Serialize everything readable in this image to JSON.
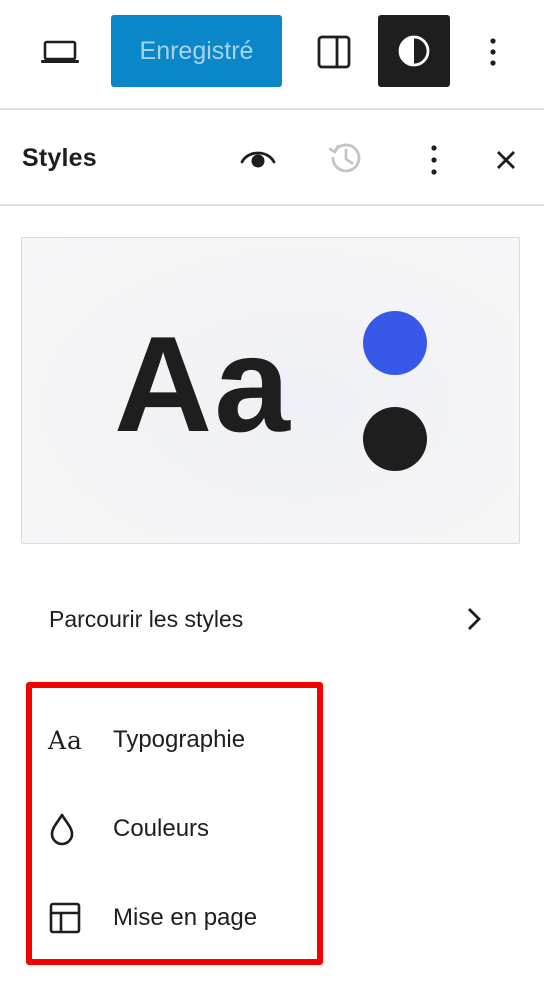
{
  "toolbar": {
    "device_icon": "laptop-icon",
    "save_label": "Enregistré",
    "sidebar_icon": "sidebar-toggle-icon",
    "styles_icon": "half-circle-contrast-icon",
    "more_icon": "vertical-ellipsis-icon"
  },
  "panel": {
    "title": "Styles",
    "actions": [
      "eye-icon",
      "revisions-history-icon",
      "vertical-ellipsis-icon",
      "close-icon"
    ]
  },
  "preview": {
    "sample_text": "Aa",
    "colors": {
      "primary": "#3858e9",
      "secondary": "#1e1e1e"
    }
  },
  "browse": {
    "label": "Parcourir les styles",
    "icon": "chevron-right-icon"
  },
  "nav": {
    "items": [
      {
        "label": "Typographie",
        "icon": "typography-icon",
        "icon_text": "Aa"
      },
      {
        "label": "Couleurs",
        "icon": "droplet-icon"
      },
      {
        "label": "Mise en page",
        "icon": "layout-icon"
      }
    ]
  },
  "colors": {
    "accent": "#0a87c9",
    "highlight_border": "#f80000",
    "dark": "#1e1e1e"
  }
}
